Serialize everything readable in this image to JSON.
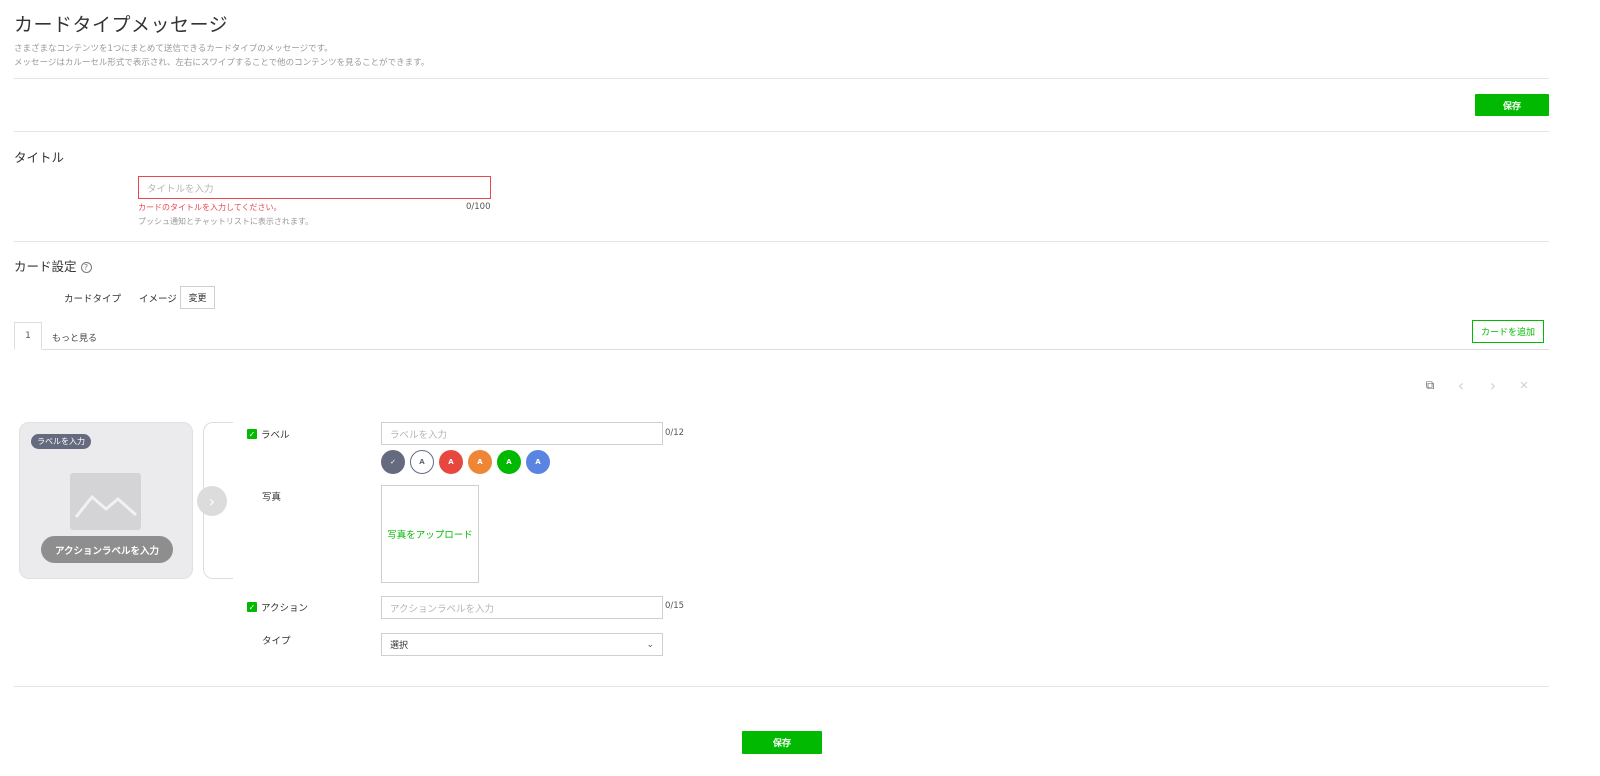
{
  "header": {
    "title": "カードタイプメッセージ",
    "desc1": "さまざまなコンテンツを1つにまとめて送信できるカードタイプのメッセージです。",
    "desc2": "メッセージはカルーセル形式で表示され、左右にスワイプすることで他のコンテンツを見ることができます。",
    "save_label": "保存"
  },
  "title_section": {
    "heading": "タイトル",
    "placeholder": "タイトルを入力",
    "error": "カードのタイトルを入力してください。",
    "counter": "0/100",
    "hint": "プッシュ通知とチャットリストに表示されます。"
  },
  "card_settings": {
    "heading": "カード設定",
    "help_icon": "?",
    "type_label": "カードタイプ",
    "type_value": "イメージ",
    "change_label": "変更"
  },
  "tabs": {
    "items": [
      "1",
      "もっと見る"
    ],
    "add_card_label": "カードを追加"
  },
  "toolbar": {
    "copy_icon": "⧉",
    "prev_icon": "‹",
    "next_icon": "›",
    "close_icon": "✕"
  },
  "preview": {
    "label_badge": "ラベルを入力",
    "action_label": "アクションラベルを入力",
    "next_icon": "›"
  },
  "form": {
    "label_field": {
      "label": "ラベル",
      "placeholder": "ラベルを入力",
      "counter": "0/12"
    },
    "swatches": [
      {
        "text": "✓",
        "color": "#666a7f"
      },
      {
        "text": "A",
        "color": "#ffffff"
      },
      {
        "text": "A",
        "color": "#e8473f"
      },
      {
        "text": "A",
        "color": "#ef8536"
      },
      {
        "text": "A",
        "color": "#00b900"
      },
      {
        "text": "A",
        "color": "#5a84e2"
      }
    ],
    "photo": {
      "label": "写真",
      "upload_label": "写真をアップロード"
    },
    "action_field": {
      "label": "アクション",
      "placeholder": "アクションラベルを入力",
      "counter": "0/15"
    },
    "type_field": {
      "label": "タイプ",
      "selected": "選択",
      "chevron": "⌄"
    }
  },
  "footer": {
    "save_label": "保存"
  }
}
